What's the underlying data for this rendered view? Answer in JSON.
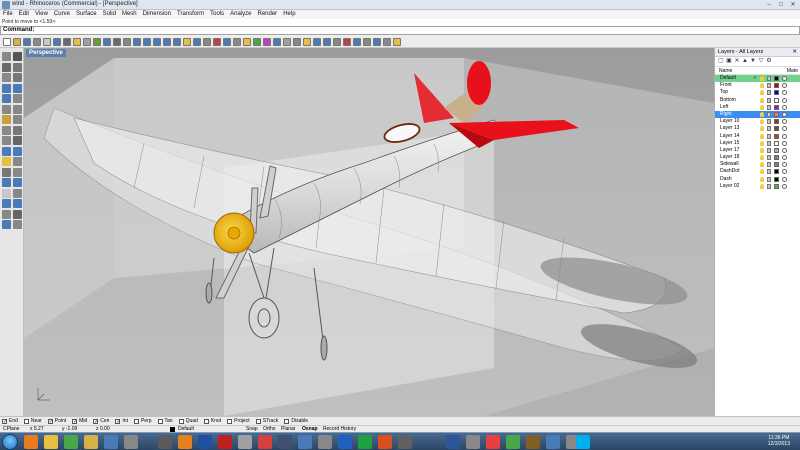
{
  "window": {
    "title": "wind - Rhinoceros (Commercial) - [Perspective]",
    "buttons": {
      "minimize": "–",
      "maximize": "□",
      "close": "✕"
    }
  },
  "menu": [
    "File",
    "Edit",
    "View",
    "Curve",
    "Surface",
    "Solid",
    "Mesh",
    "Dimension",
    "Transform",
    "Tools",
    "Analyze",
    "Render",
    "Help"
  ],
  "command": {
    "history": "Point to move to <1.59>:",
    "prompt": "Command:"
  },
  "viewport": {
    "title": "Perspective",
    "colors": {
      "background": "#a6a6a6",
      "accent_red": "#e8101a",
      "cowl_yellow": "#f0b800"
    }
  },
  "layers": {
    "panel_title": "Layers - All Layers",
    "col_name": "Name",
    "col_material": "Mate",
    "items": [
      {
        "name": "Default",
        "color": "#000000",
        "current": true
      },
      {
        "name": "Front",
        "color": "#cc0000"
      },
      {
        "name": "Top",
        "color": "#0000cc"
      },
      {
        "name": "Bottom",
        "color": "#ffffff"
      },
      {
        "name": "Left",
        "color": "#cc00cc"
      },
      {
        "name": "Right",
        "color": "#ff8040",
        "selected": true
      },
      {
        "name": "Layer 10",
        "color": "#804040"
      },
      {
        "name": "Layer 13",
        "color": "#804040"
      },
      {
        "name": "Layer 14",
        "color": "#c04020"
      },
      {
        "name": "Layer 15",
        "color": "#ffffff"
      },
      {
        "name": "Layer 17",
        "color": "#c0a0a0"
      },
      {
        "name": "Layer 18",
        "color": "#808080"
      },
      {
        "name": "Sidewall",
        "color": "#808080"
      },
      {
        "name": "DashDot",
        "color": "#000000"
      },
      {
        "name": "Dash",
        "color": "#000000"
      },
      {
        "name": "Layer 02",
        "color": "#40c040"
      }
    ]
  },
  "osnap": [
    "End",
    "Near",
    "Point",
    "Mid",
    "Cen",
    "Int",
    "Perp",
    "Tan",
    "Quad",
    "Knot",
    "Project",
    "STrack",
    "Disable"
  ],
  "osnap_checked": [
    true,
    false,
    true,
    true,
    true,
    true,
    false,
    false,
    false,
    false,
    false,
    false,
    false
  ],
  "status": {
    "cplane": "CPlane",
    "x": "x 5.27",
    "y": "y -1.09",
    "z": "z 0.00",
    "layer": "Default",
    "snap": "Snap",
    "ortho": "Ortho",
    "planar": "Planar",
    "osnap": "Osnap",
    "record": "Record History"
  },
  "taskbar": {
    "time": "11:36 PM",
    "date": "12/3/2013"
  }
}
